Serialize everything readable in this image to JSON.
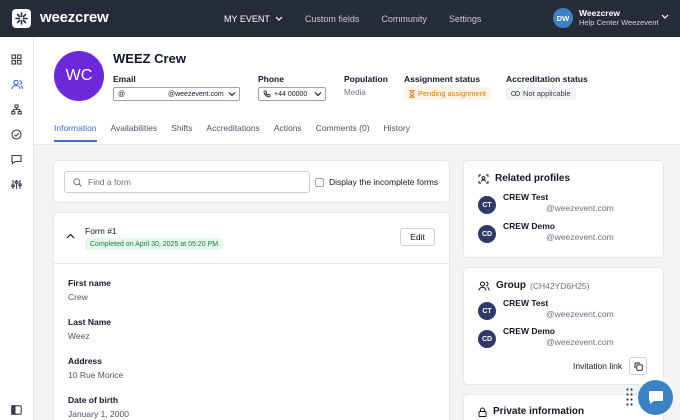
{
  "topbar": {
    "logo_text": "weezcrew",
    "nav": [
      {
        "label": "MY EVENT",
        "active": true
      },
      {
        "label": "Custom fields",
        "active": false
      },
      {
        "label": "Community",
        "active": false
      },
      {
        "label": "Settings",
        "active": false
      }
    ],
    "user": {
      "initials": "DW",
      "name": "Weezcrew",
      "subtitle": "Help Center Weezevent"
    }
  },
  "sidebar": {
    "icons": [
      "dashboard-icon",
      "users-icon",
      "org-chart-icon",
      "check-circle-icon",
      "chat-icon",
      "sliders-icon",
      "collapse-sidebar-icon"
    ]
  },
  "profile": {
    "initials": "WC",
    "name": "WEEZ Crew",
    "email": {
      "label": "Email",
      "prefix": "@",
      "domain": "@weezevent.com"
    },
    "phone": {
      "label": "Phone",
      "value": "+44 00000"
    },
    "population": {
      "label": "Population",
      "value": "Media"
    },
    "assignment": {
      "label": "Assignment status",
      "value": "Pending assignment"
    },
    "accreditation": {
      "label": "Accreditation status",
      "value": "Not applicable"
    },
    "tabs": [
      {
        "label": "Information",
        "active": true
      },
      {
        "label": "Availabilities",
        "active": false
      },
      {
        "label": "Shifts",
        "active": false
      },
      {
        "label": "Accreditations",
        "active": false
      },
      {
        "label": "Actions",
        "active": false
      },
      {
        "label": "Comments (0)",
        "active": false
      },
      {
        "label": "History",
        "active": false
      }
    ]
  },
  "forms_filter": {
    "search_placeholder": "Find a form",
    "checkbox_label": "Display the incomplete forms"
  },
  "form": {
    "title": "Form #1",
    "status": "Completed on April 30, 2025 at 05:20 PM",
    "edit_label": "Edit",
    "fields": [
      {
        "label": "First name",
        "value": "Crew"
      },
      {
        "label": "Last Name",
        "value": "Weez"
      },
      {
        "label": "Address",
        "value": "10 Rue Morice"
      },
      {
        "label": "Date of birth",
        "value": "January 1, 2000"
      }
    ]
  },
  "related_profiles": {
    "title": "Related profiles",
    "people": [
      {
        "initials": "CT",
        "name": "CREW Test",
        "email": "@weezevent.com"
      },
      {
        "initials": "CD",
        "name": "CREW Demo",
        "email": "@weezevent.com"
      }
    ]
  },
  "group": {
    "title": "Group",
    "code": "(CH42YD6H25)",
    "people": [
      {
        "initials": "CT",
        "name": "CREW Test",
        "email": "@weezevent.com"
      },
      {
        "initials": "CD",
        "name": "CREW Demo",
        "email": "@weezevent.com"
      }
    ],
    "invitation_label": "Invitation link"
  },
  "private_info": {
    "title": "Private information"
  },
  "colors": {
    "topbar": "#262b3a",
    "accent": "#3b6fd4",
    "avatar": "#6d28d9",
    "chat": "#3b82c4"
  }
}
